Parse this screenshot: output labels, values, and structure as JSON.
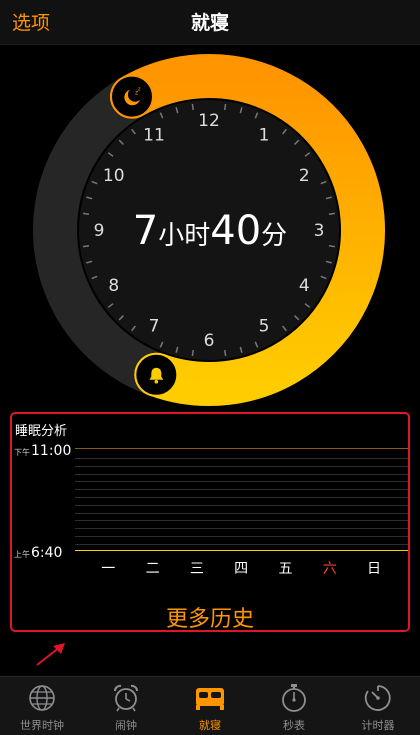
{
  "nav": {
    "left_label": "选项",
    "title": "就寝"
  },
  "clock": {
    "hours": [
      "12",
      "1",
      "2",
      "3",
      "4",
      "5",
      "6",
      "7",
      "8",
      "9",
      "10",
      "11"
    ],
    "duration": {
      "hours": "7",
      "hours_unit": "小时",
      "minutes": "40",
      "minutes_unit": "分"
    },
    "bedtime_icon": "moon-sleep-icon",
    "wake_icon": "alarm-bell-icon",
    "accent": "#ff9500"
  },
  "analysis": {
    "title": "睡眠分析",
    "top_ampm": "下午",
    "top_time": "11:00",
    "bottom_ampm": "上午",
    "bottom_time": "6:40",
    "days": [
      "一",
      "二",
      "三",
      "四",
      "五",
      "六",
      "日"
    ],
    "highlight_day_color": "#ff3b30",
    "more": "更多历史",
    "border_color": "#e0142a"
  },
  "tabs": [
    {
      "label": "世界时钟",
      "icon": "globe-icon"
    },
    {
      "label": "闹钟",
      "icon": "alarm-clock-icon"
    },
    {
      "label": "就寝",
      "icon": "bed-icon",
      "active": true
    },
    {
      "label": "秒表",
      "icon": "stopwatch-icon"
    },
    {
      "label": "计时器",
      "icon": "timer-icon"
    }
  ]
}
